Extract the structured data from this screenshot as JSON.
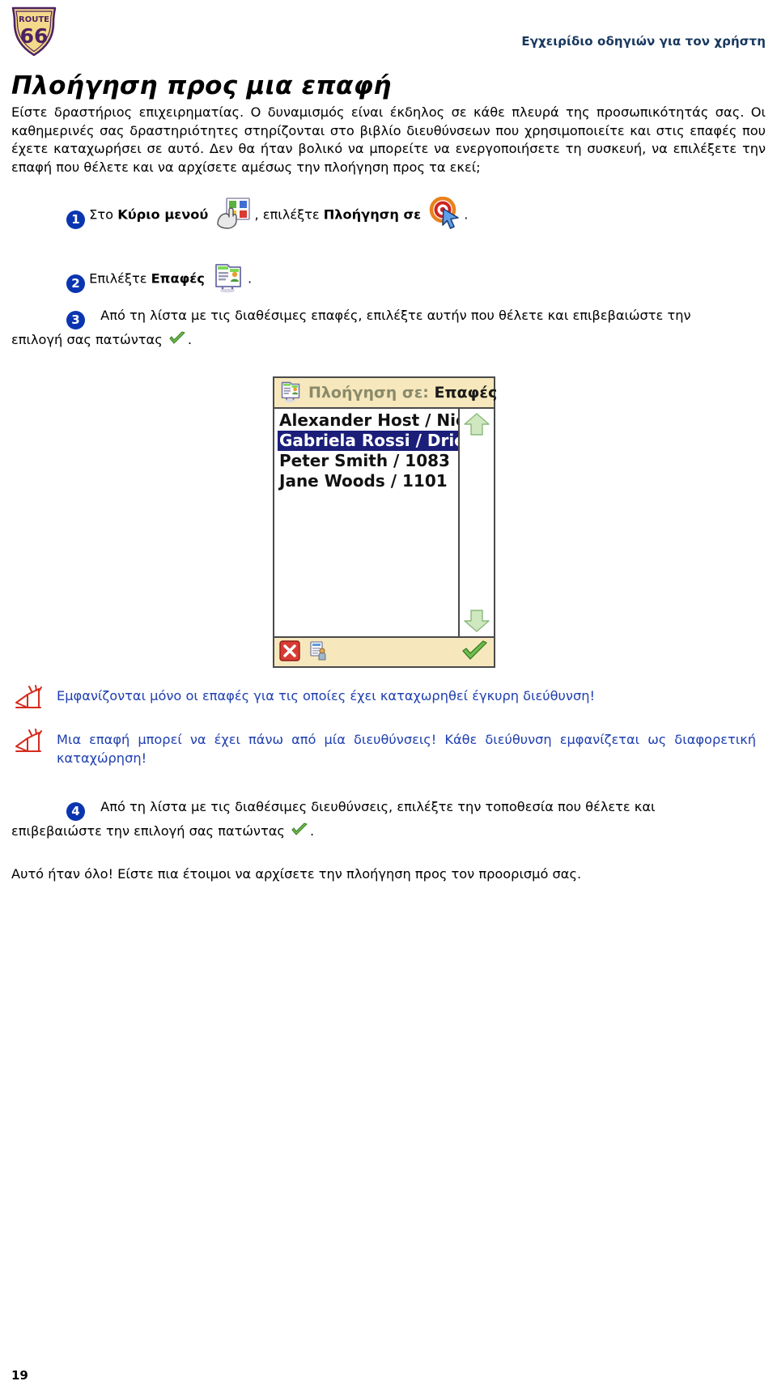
{
  "header": {
    "title": "Εγχειρίδιο οδηγιών για τον χρήστη",
    "logo_top": "ROUTE",
    "logo_num": "66"
  },
  "page_title": "Πλοήγηση προς μια επαφή",
  "intro": "Είστε δραστήριος επιχειρηματίας. Ο δυναμισμός είναι έκδηλος σε κάθε πλευρά της προσωπικότητάς σας. Οι καθημερινές σας δραστηριότητες στηρίζονται στο βιβλίο διευθύνσεων που χρησιμοποιείτε και στις επαφές που έχετε καταχωρήσει σε αυτό. Δεν θα ήταν βολικό να μπορείτε να ενεργοποιήσετε τη συσκευή, να επιλέξετε την επαφή που θέλετε και να αρχίσετε αμέσως την πλοήγηση προς τα εκεί;",
  "steps": [
    {
      "num": "1",
      "part1": "Στο ",
      "bold1": "Κύριο μενού",
      "icon1": "main-menu-icon",
      "part2": ", επιλέξτε ",
      "bold2": "Πλοήγηση σε",
      "icon2": "navigate-to-icon",
      "part3": "."
    },
    {
      "num": "2",
      "part1": "Επιλέξτε ",
      "bold1": "Επαφές",
      "icon1": "contacts-icon",
      "part2": "."
    },
    {
      "num": "3",
      "text": "Από τη λίστα με τις διαθέσιμες επαφές, επιλέξτε αυτήν που θέλετε και επιβεβαιώστε την",
      "text2": "επιλογή σας πατώντας",
      "icon": "green-check-icon",
      "tail": "."
    },
    {
      "num": "4",
      "text": "Από τη λίστα με τις διαθέσιμες διευθύνσεις, επιλέξτε την τοποθεσία που θέλετε και",
      "text2": "επιβεβαιώστε την επιλογή σας πατώντας",
      "icon": "green-check-icon",
      "tail": "."
    }
  ],
  "device": {
    "title_prefix": "Πλοήγηση σε: ",
    "title_value": "Επαφές",
    "title_icon": "contacts-icon",
    "list": [
      {
        "label": "Alexander Host / Nie...",
        "selected": false
      },
      {
        "label": "Gabriela Rossi / Drie...",
        "selected": true
      },
      {
        "label": "Peter Smith / 1083",
        "selected": false
      },
      {
        "label": "Jane Woods / 1101",
        "selected": false
      }
    ],
    "scroll_up_icon": "scroll-up-arrow-icon",
    "scroll_down_icon": "scroll-down-arrow-icon",
    "cancel_icon": "red-x-icon",
    "contact_detail_icon": "contact-detail-icon",
    "confirm_icon": "green-check-icon"
  },
  "notes": [
    "Εμφανίζονται μόνο οι επαφές για τις οποίες έχει καταχωρηθεί έγκυρη διεύθυνση!",
    "Μια επαφή μπορεί να έχει πάνω από μία διευθύνσεις! Κάθε διεύθυνση εμφανίζεται ως διαφορετική καταχώρηση!"
  ],
  "closing": "Αυτό ήταν όλο! Είστε πια έτοιμοι να αρχίσετε την πλοήγηση προς τον προορισμό σας.",
  "page_number": "19",
  "colors": {
    "logo_yellow": "#f5d98a",
    "logo_purple": "#4b2263",
    "header_blue": "#17375e",
    "step_blue": "#0b35b0",
    "note_blue": "#1f3fb0",
    "device_border": "#4a4a4a",
    "device_titlebar": "#f6e8bc",
    "selection_navy": "#1b1f7a"
  }
}
